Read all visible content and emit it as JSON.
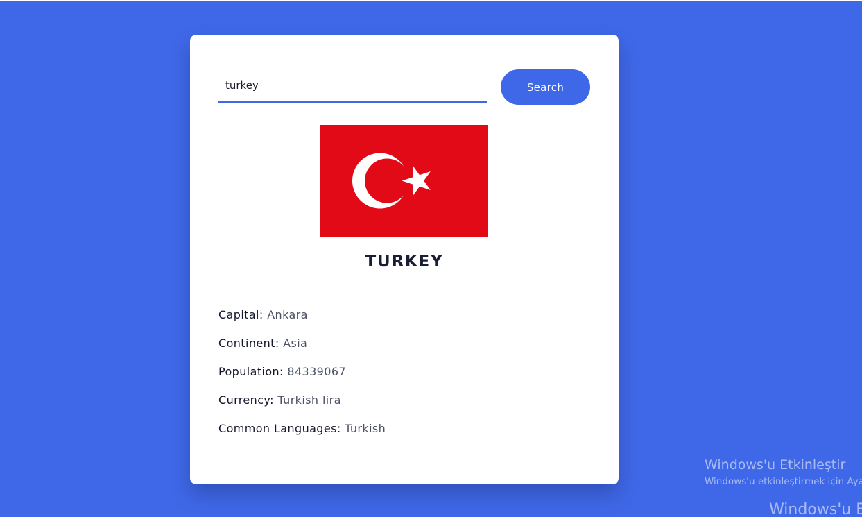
{
  "search": {
    "value": "turkey",
    "button_label": "Search"
  },
  "country": {
    "name": "TURKEY",
    "flag_icon": "turkey-flag",
    "flag_colors": {
      "field": "#e30a17",
      "emblem": "#ffffff"
    },
    "details": [
      {
        "label": "Capital:",
        "value": "Ankara"
      },
      {
        "label": "Continent:",
        "value": "Asia"
      },
      {
        "label": "Population:",
        "value": "84339067"
      },
      {
        "label": "Currency:",
        "value": "Turkish lira"
      },
      {
        "label": "Common Languages:",
        "value": "Turkish"
      }
    ]
  },
  "watermark": {
    "title": "Windows'u Etkinleştir",
    "subtitle": "Windows'u etkinleştirmek için Ayar",
    "bottom": "Windows'u E"
  },
  "colors": {
    "background": "#3f68e8",
    "card": "#ffffff",
    "accent": "#3f68e8"
  }
}
